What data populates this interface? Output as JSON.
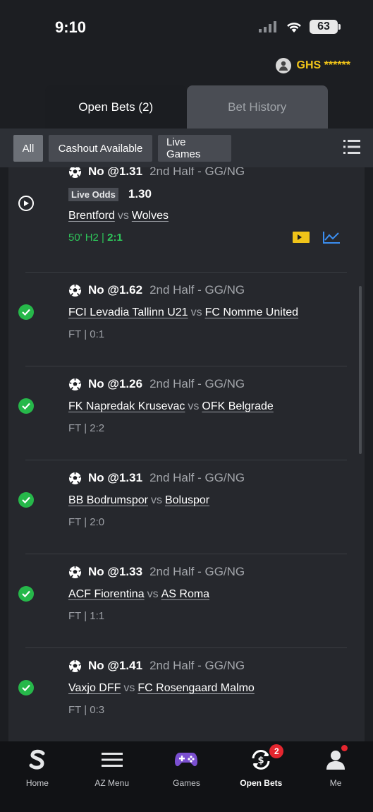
{
  "status_bar": {
    "time": "9:10",
    "battery": "63"
  },
  "balance": {
    "text": "GHS ******"
  },
  "tabs": [
    {
      "label": "Open Bets (2)",
      "active": true
    },
    {
      "label": "Bet History",
      "active": false
    }
  ],
  "filters": [
    {
      "label": "All",
      "selected": true
    },
    {
      "label": "Cashout Available",
      "selected": false
    },
    {
      "label": "Live Games",
      "selected": false
    }
  ],
  "bets": [
    {
      "pick": "No @1.31",
      "market": "2nd Half  -  GG/NG",
      "live_odds_label": "Live Odds",
      "live_odds_value": "1.30",
      "home": "Brentford",
      "vs": "vs",
      "away": "Wolves",
      "live_time": "50' H2 |",
      "live_score": "2:1",
      "status": "live"
    },
    {
      "pick": "No @1.62",
      "market": "2nd Half  -  GG/NG",
      "home": "FCI Levadia Tallinn U21",
      "vs": "vs",
      "away": "FC Nomme United",
      "result": "FT | 0:1",
      "status": "won"
    },
    {
      "pick": "No @1.26",
      "market": "2nd Half  -  GG/NG",
      "home": "FK Napredak Krusevac",
      "vs": "vs",
      "away": "OFK Belgrade",
      "result": "FT | 2:2",
      "status": "won"
    },
    {
      "pick": "No @1.31",
      "market": "2nd Half  -  GG/NG",
      "home": "BB Bodrumspor",
      "vs": "vs",
      "away": "Boluspor",
      "result": "FT | 2:0",
      "status": "won"
    },
    {
      "pick": "No @1.33",
      "market": "2nd Half  -  GG/NG",
      "home": "ACF Fiorentina",
      "vs": "vs",
      "away": "AS Roma",
      "result": "FT | 1:1",
      "status": "won"
    },
    {
      "pick": "No @1.41",
      "market": "2nd Half  -  GG/NG",
      "home": "Vaxjo DFF",
      "vs": "vs",
      "away": "FC Rosengaard Malmo",
      "result": "FT | 0:3",
      "status": "won"
    }
  ],
  "nav": [
    {
      "label": "Home",
      "icon": "sportybet-logo-icon"
    },
    {
      "label": "AZ Menu",
      "icon": "hamburger-icon"
    },
    {
      "label": "Games",
      "icon": "gamepad-icon"
    },
    {
      "label": "Open Bets",
      "icon": "open-bets-icon",
      "badge": "2",
      "active": true
    },
    {
      "label": "Me",
      "icon": "user-icon"
    }
  ],
  "colors": {
    "accent_green": "#26b84a",
    "balance_yellow": "#f0c419",
    "badge_red": "#e5262f"
  }
}
